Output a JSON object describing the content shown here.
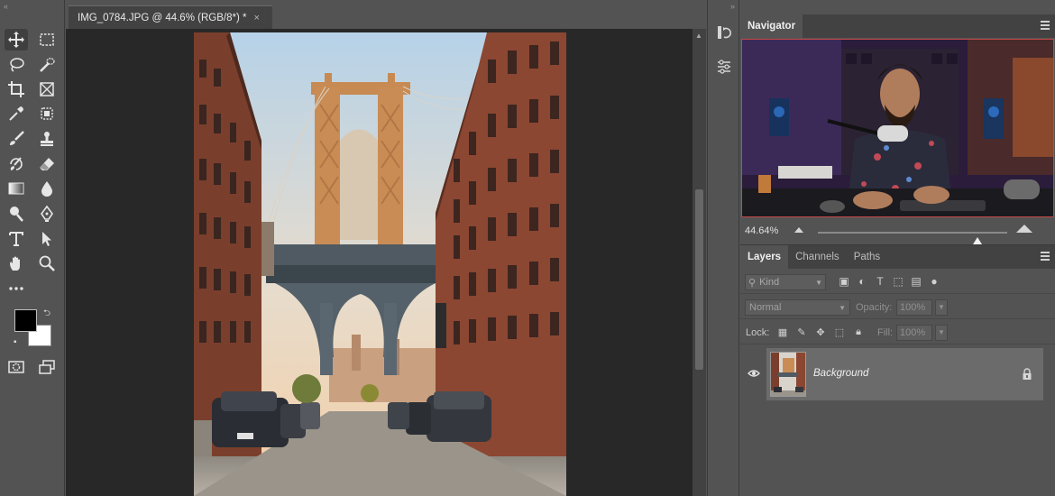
{
  "document": {
    "tab_title": "IMG_0784.JPG @ 44.6% (RGB/8*) *",
    "close_glyph": "×"
  },
  "toolbar": {
    "tools": [
      "move-icon",
      "marquee-icon",
      "lasso-icon",
      "quick-selection-icon",
      "crop-icon",
      "frame-icon",
      "eyedropper-icon",
      "patch-icon",
      "brush-icon",
      "stamp-icon",
      "history-brush-icon",
      "eraser-icon",
      "gradient-icon",
      "blur-icon",
      "dodge-icon",
      "pen-icon",
      "type-icon",
      "path-selection-icon",
      "hand-icon",
      "zoom-icon",
      "more-tools-icon"
    ],
    "foreground_color": "#000000",
    "background_color": "#ffffff"
  },
  "navigator": {
    "title": "Navigator",
    "zoom": "44.64%"
  },
  "layers_panel": {
    "tabs": [
      "Layers",
      "Channels",
      "Paths"
    ],
    "active_tab": "Layers",
    "kind_filter": "Kind",
    "blend_mode": "Normal",
    "opacity_label": "Opacity:",
    "opacity_value": "100%",
    "lock_label": "Lock:",
    "fill_label": "Fill:",
    "fill_value": "100%",
    "layers": [
      {
        "name": "Background",
        "visible": true,
        "locked": true
      }
    ]
  },
  "colors": {
    "panel_bg": "#535353",
    "canvas_bg": "#282828",
    "tab_bg": "#424242",
    "selected_layer": "#6b6b6b",
    "navigator_box": "#c54848"
  }
}
